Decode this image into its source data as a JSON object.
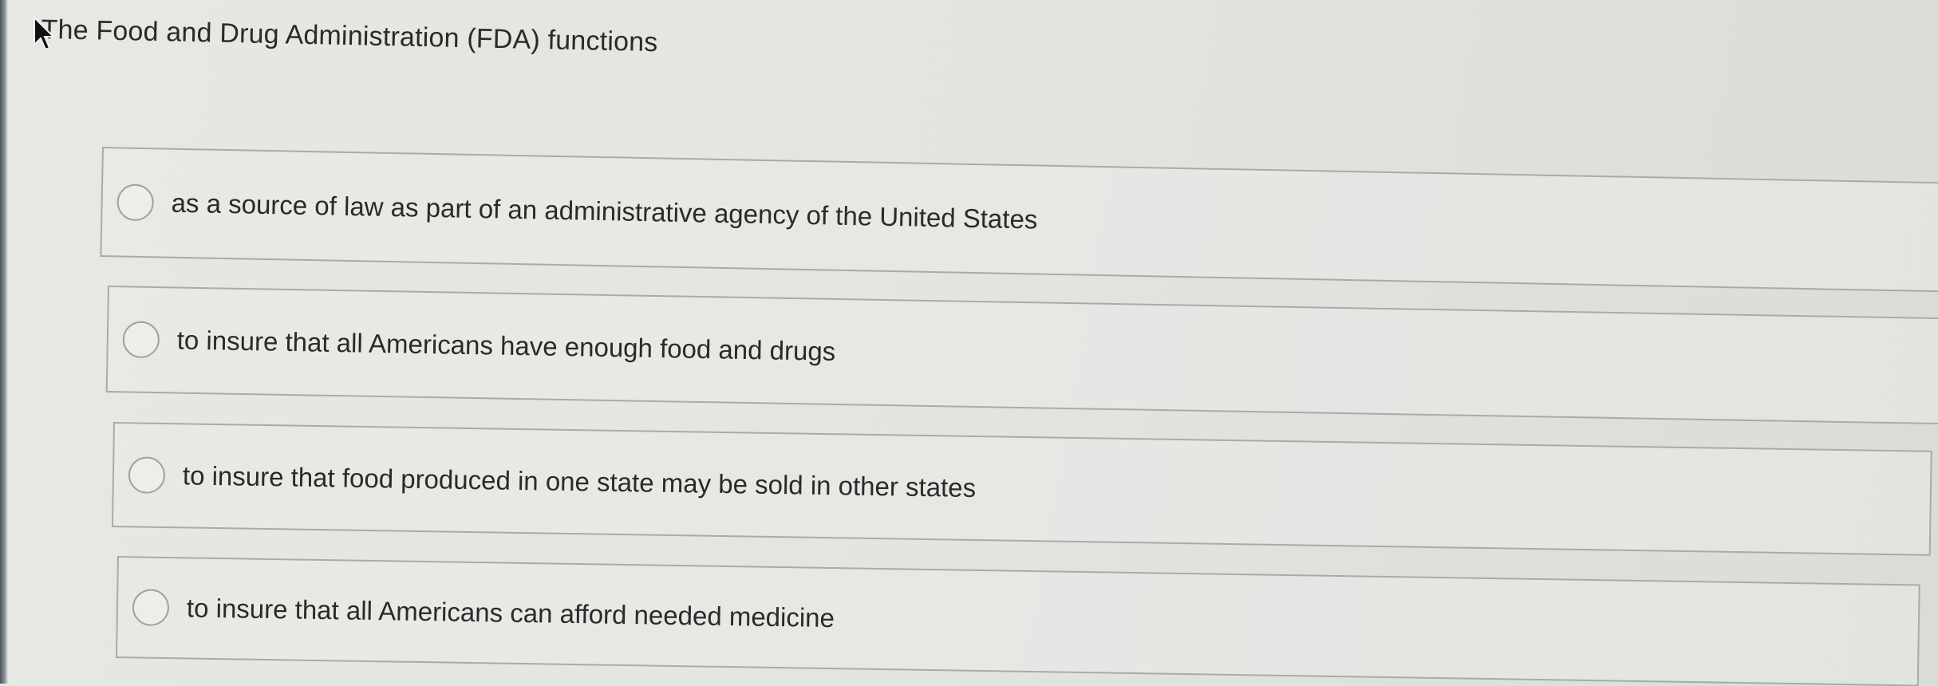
{
  "question": {
    "text": "The Food and Drug Administration (FDA) functions"
  },
  "options": [
    {
      "label": "as a source of law as part of an administrative agency of the United States",
      "selected": false
    },
    {
      "label": "to insure that all Americans have enough food and drugs",
      "selected": false
    },
    {
      "label": "to insure that food produced in one state may be sold in other states",
      "selected": false
    },
    {
      "label": "to insure that all Americans can afford needed medicine",
      "selected": false
    }
  ],
  "icons": {
    "cursor": "mouse-pointer-icon",
    "radio": "radio-button-unselected-icon"
  }
}
